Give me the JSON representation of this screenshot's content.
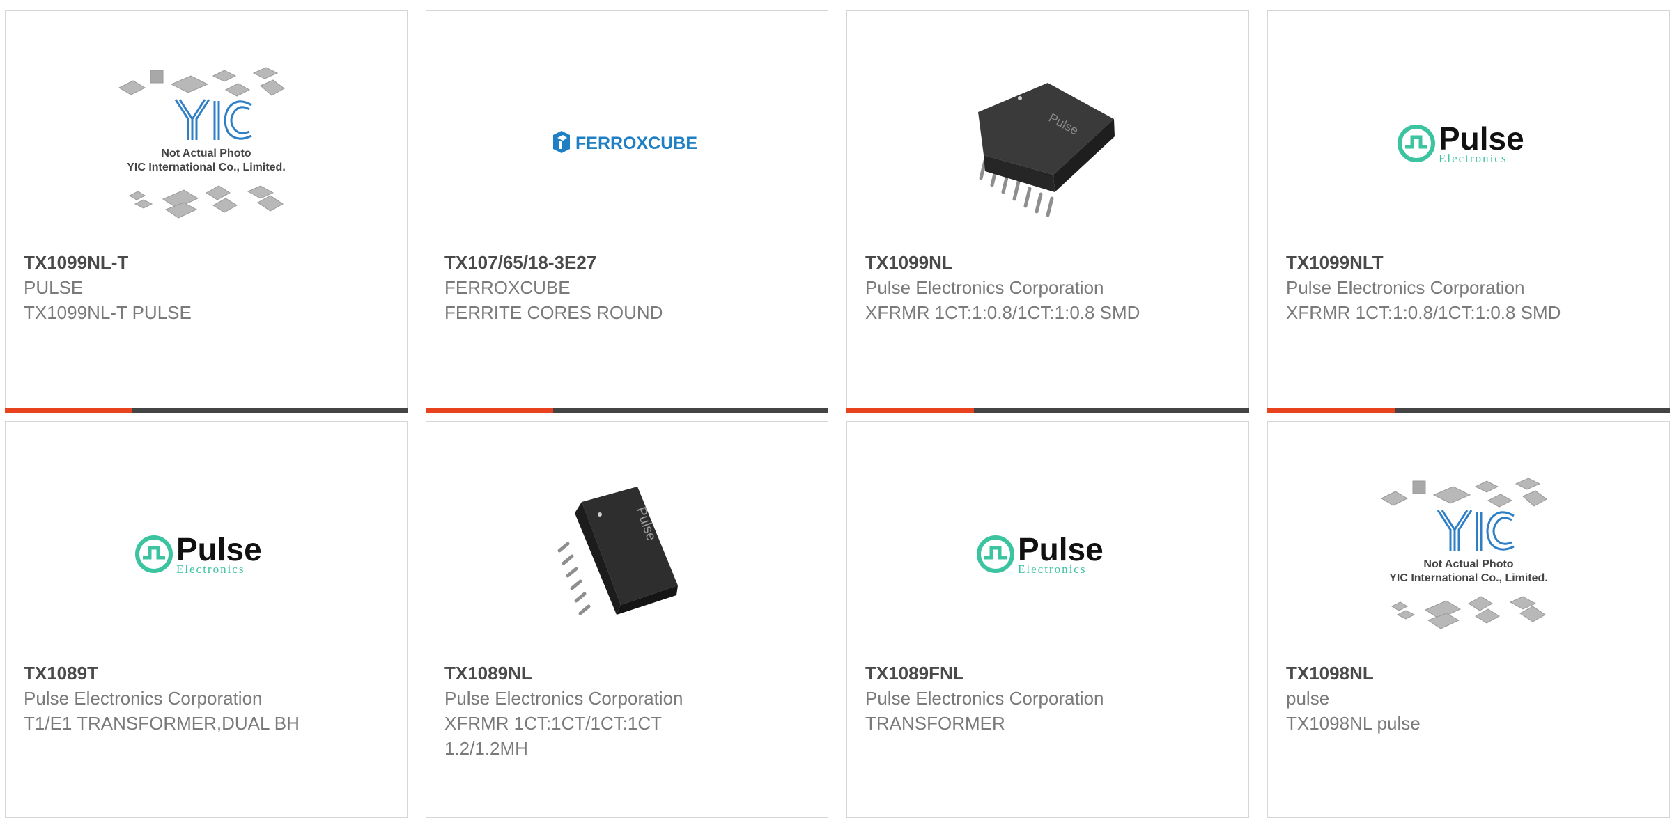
{
  "colors": {
    "accent_bar": "#e8421e",
    "dark_bar": "#444444",
    "pulse_teal": "#3cc3a0",
    "ferroxcube_blue": "#1e7fc4",
    "yic_blue": "#2f7fc6"
  },
  "products": [
    {
      "part_number": "TX1099NL-T",
      "manufacturer": "PULSE",
      "description": "TX1099NL-T PULSE",
      "image": "yic-placeholder",
      "placeholder_caption_1": "Not Actual Photo",
      "placeholder_caption_2": "YIC International Co., Limited.",
      "logo_letters": "YIC"
    },
    {
      "part_number": "TX107/65/18-3E27",
      "manufacturer": "FERROXCUBE",
      "description": "FERRITE CORES ROUND",
      "image": "ferroxcube-logo",
      "logo_text": "FERROXCUBE"
    },
    {
      "part_number": "TX1099NL",
      "manufacturer": "Pulse Electronics Corporation",
      "description": "XFRMR 1CT:1:0.8/1CT:1:0.8 SMD",
      "image": "smd-transformer-photo"
    },
    {
      "part_number": "TX1099NLT",
      "manufacturer": "Pulse Electronics Corporation",
      "description": "XFRMR 1CT:1:0.8/1CT:1:0.8 SMD",
      "image": "pulse-logo",
      "logo_text": "Pulse",
      "logo_subtext": "Electronics"
    },
    {
      "part_number": "TX1089T",
      "manufacturer": "Pulse Electronics Corporation",
      "description": "T1/E1 TRANSFORMER,DUAL BH",
      "image": "pulse-logo",
      "logo_text": "Pulse",
      "logo_subtext": "Electronics"
    },
    {
      "part_number": "TX1089NL",
      "manufacturer": "Pulse Electronics Corporation",
      "description": "XFRMR 1CT:1CT/1CT:1CT 1.2/1.2MH",
      "image": "smd-transformer-photo"
    },
    {
      "part_number": "TX1089FNL",
      "manufacturer": "Pulse Electronics Corporation",
      "description": "TRANSFORMER",
      "image": "pulse-logo",
      "logo_text": "Pulse",
      "logo_subtext": "Electronics"
    },
    {
      "part_number": "TX1098NL",
      "manufacturer": "pulse",
      "description": "TX1098NL pulse",
      "image": "yic-placeholder",
      "placeholder_caption_1": "Not Actual Photo",
      "placeholder_caption_2": "YIC International Co., Limited.",
      "logo_letters": "YIC"
    }
  ]
}
